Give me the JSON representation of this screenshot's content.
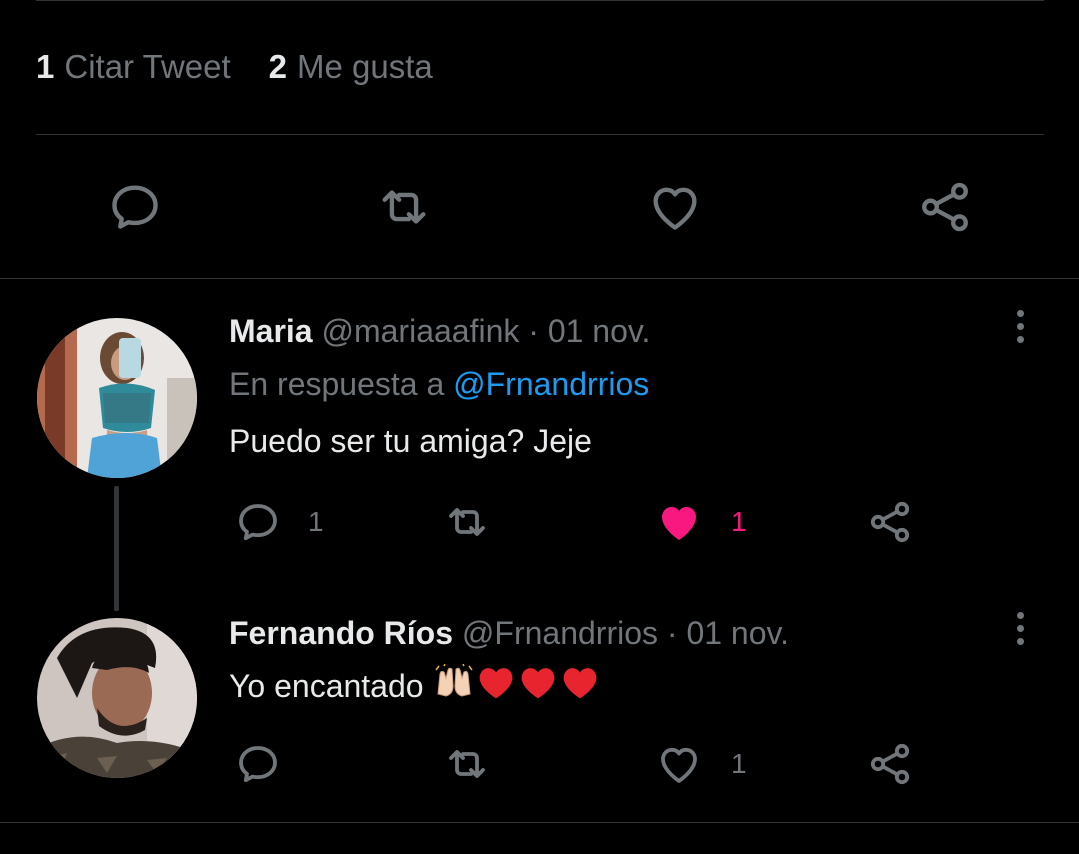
{
  "stats": {
    "quotes_count": "1",
    "quotes_label": "Citar Tweet",
    "likes_count": "2",
    "likes_label": "Me gusta"
  },
  "main_actions": [
    "reply-icon",
    "retweet-icon",
    "like-icon",
    "share-icon"
  ],
  "replies": [
    {
      "name": "Maria",
      "handle": "@mariaaafink",
      "date": "· 01 nov.",
      "reply_prefix": "En respuesta a",
      "reply_to": "@Frnandrrios",
      "text": "Puedo ser tu amiga? Jeje",
      "reply_count": "1",
      "like_count": "1",
      "liked": true
    },
    {
      "name": "Fernando Ríos",
      "handle": "@Frnandrrios",
      "date": "· 01 nov.",
      "text": "Yo encantado",
      "emojis": [
        "🙌",
        "❤️",
        "❤️",
        "❤️"
      ],
      "like_count": "1",
      "liked": false
    }
  ],
  "colors": {
    "background": "#000000",
    "text": "#e7e9ea",
    "muted": "#71767b",
    "link": "#1d9bf0",
    "like": "#f91880",
    "divider": "#2f3336"
  }
}
